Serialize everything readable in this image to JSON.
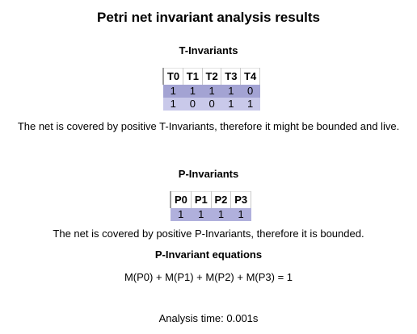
{
  "title": "Petri net invariant analysis results",
  "t_invariants": {
    "heading": "T-Invariants",
    "columns": [
      "T0",
      "T1",
      "T2",
      "T3",
      "T4"
    ],
    "rows": [
      [
        "1",
        "1",
        "1",
        "1",
        "0"
      ],
      [
        "1",
        "0",
        "0",
        "1",
        "1"
      ]
    ],
    "row_colors": [
      "#a3a3d3",
      "#c9c9ea"
    ],
    "conclusion": "The net is covered by positive T-Invariants, therefore it might be bounded and live."
  },
  "p_invariants": {
    "heading": "P-Invariants",
    "columns": [
      "P0",
      "P1",
      "P2",
      "P3"
    ],
    "rows": [
      [
        "1",
        "1",
        "1",
        "1"
      ]
    ],
    "row_colors": [
      "#b0b0dc"
    ],
    "conclusion": "The net is covered by positive P-Invariants, therefore it is bounded."
  },
  "p_equations": {
    "heading": "P-Invariant equations",
    "equation": "M(P0) + M(P1) + M(P2) + M(P3) = 1"
  },
  "analysis_time": "Analysis time: 0.001s"
}
